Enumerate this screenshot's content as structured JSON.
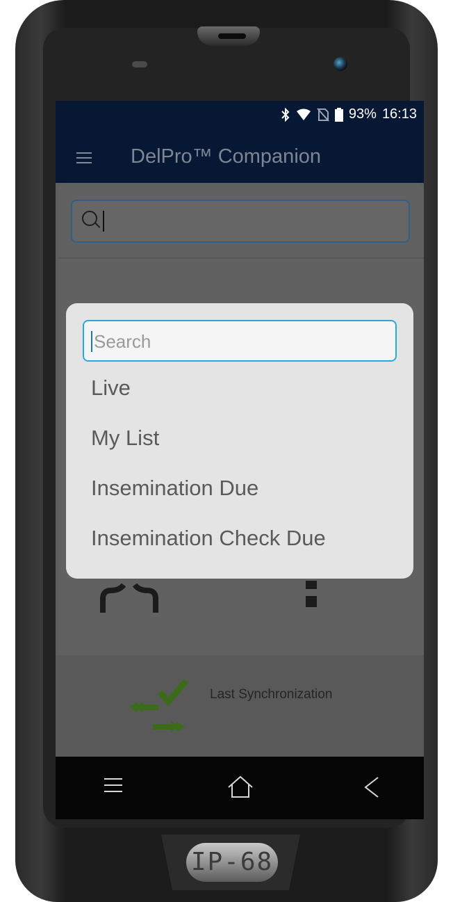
{
  "status_bar": {
    "bluetooth_icon": "bluetooth-icon",
    "wifi_icon": "wifi-icon",
    "sim_icon": "no-sim-icon",
    "battery_icon": "battery-icon",
    "battery": "93%",
    "time": "16:13"
  },
  "app_bar": {
    "menu_icon": "hamburger-menu-icon",
    "title": "DelPro™ Companion"
  },
  "top_search": {
    "icon": "search-icon",
    "value": ""
  },
  "dialog": {
    "search_placeholder": "Search",
    "options": [
      "Live",
      "My List",
      "Insemination Due",
      "Insemination Check Due"
    ]
  },
  "footer": {
    "sync_icon": "sync-arrows-check-icon",
    "sync_label": "Last Synchronization"
  },
  "nav_bar": {
    "menu_icon": "menu-icon",
    "home_icon": "home-icon",
    "back_icon": "back-icon"
  },
  "device": {
    "badge": "IP-68"
  },
  "colors": {
    "app_bar": "#061833",
    "dialog_bg": "#e4e4e4",
    "search_focus": "#29a8e0",
    "sync_green": "#3d6b1c"
  }
}
